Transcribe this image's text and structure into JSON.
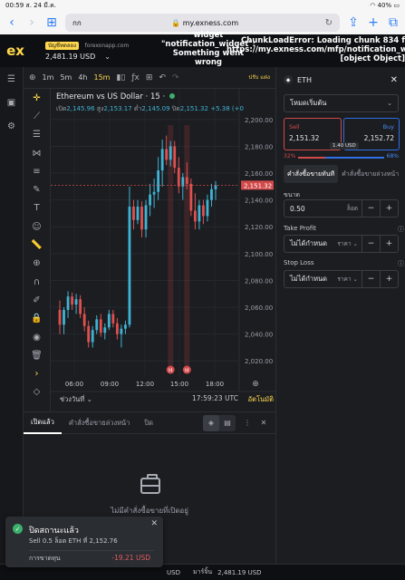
{
  "statusbar": {
    "time": "00:59",
    "date": "ส. 24 มี.ค.",
    "battery": "40%"
  },
  "safari": {
    "aa": "กก",
    "url": "my.exness.com"
  },
  "header": {
    "logo": "ex",
    "account_tag": "บัญชีทดลอง",
    "server": "forexonapp.com",
    "balance": "2,481.19 USD",
    "notification_error": [
      "widget",
      "\"notification_widget\":",
      "Something went",
      "wrong"
    ],
    "chunk_error": [
      "ChunkLoadError: Loading chunk 834 f",
      "https://my.exness.com/mfp/notification_widget",
      "[object Object]"
    ]
  },
  "chart_toolbar": {
    "timeframes": [
      "1m",
      "5m",
      "4h",
      "15m"
    ],
    "active_timeframe": "15m",
    "right_label": "ปรับ แต่ง"
  },
  "chart": {
    "legend": "Ethereum vs US Dollar · 15 ·",
    "ohlc": {
      "open_label": "เปิด",
      "open": "2,145.96",
      "high_label": "สูง",
      "high": "2,153.17",
      "low_label": "ต่ำ",
      "low": "2,145.09",
      "close_label": "ปิด",
      "close": "2,151.32",
      "change": "+5.38 (+0"
    },
    "range_button": "ช่วงวันที่",
    "clock": "17:59:23 UTC",
    "auto_button": "อัตโนมัติ",
    "colors": {
      "up": "#3fb3d4",
      "down": "#e0504f",
      "price_tag": "#d24a4a"
    }
  },
  "chart_data": {
    "type": "candlestick",
    "x_ticks": [
      "06:00",
      "09:00",
      "12:00",
      "15:00",
      "18:00"
    ],
    "y_ticks": [
      2020,
      2040,
      2060,
      2080,
      2100,
      2120,
      2140,
      2160,
      2180,
      2200
    ],
    "y_tick_labels": [
      "2,020.00",
      "2,040.00",
      "2,060.00",
      "2,080.00",
      "2,100.00",
      "2,120.00",
      "2,140.00",
      "2,160.00",
      "2,180.00",
      "2,200.00"
    ],
    "ylim": [
      2008,
      2208
    ],
    "current_price": "2,151.32",
    "candles": [
      {
        "o": 2058,
        "h": 2065,
        "l": 2040,
        "c": 2047
      },
      {
        "o": 2047,
        "h": 2060,
        "l": 2040,
        "c": 2058
      },
      {
        "o": 2058,
        "h": 2072,
        "l": 2052,
        "c": 2068
      },
      {
        "o": 2068,
        "h": 2071,
        "l": 2058,
        "c": 2062
      },
      {
        "o": 2062,
        "h": 2070,
        "l": 2055,
        "c": 2066
      },
      {
        "o": 2066,
        "h": 2069,
        "l": 2052,
        "c": 2055
      },
      {
        "o": 2055,
        "h": 2060,
        "l": 2042,
        "c": 2046
      },
      {
        "o": 2046,
        "h": 2050,
        "l": 2030,
        "c": 2034
      },
      {
        "o": 2034,
        "h": 2046,
        "l": 2030,
        "c": 2043
      },
      {
        "o": 2043,
        "h": 2054,
        "l": 2040,
        "c": 2051
      },
      {
        "o": 2051,
        "h": 2055,
        "l": 2038,
        "c": 2041
      },
      {
        "o": 2041,
        "h": 2048,
        "l": 2036,
        "c": 2045
      },
      {
        "o": 2045,
        "h": 2058,
        "l": 2043,
        "c": 2055
      },
      {
        "o": 2055,
        "h": 2058,
        "l": 2045,
        "c": 2048
      },
      {
        "o": 2048,
        "h": 2052,
        "l": 2036,
        "c": 2040
      },
      {
        "o": 2040,
        "h": 2047,
        "l": 2030,
        "c": 2044
      },
      {
        "o": 2044,
        "h": 2050,
        "l": 2040,
        "c": 2047
      },
      {
        "o": 2047,
        "h": 2150,
        "l": 2045,
        "c": 2135
      },
      {
        "o": 2135,
        "h": 2140,
        "l": 2118,
        "c": 2125
      },
      {
        "o": 2125,
        "h": 2140,
        "l": 2122,
        "c": 2135
      },
      {
        "o": 2135,
        "h": 2139,
        "l": 2112,
        "c": 2118
      },
      {
        "o": 2118,
        "h": 2140,
        "l": 2112,
        "c": 2136
      },
      {
        "o": 2136,
        "h": 2152,
        "l": 2128,
        "c": 2144
      },
      {
        "o": 2144,
        "h": 2156,
        "l": 2134,
        "c": 2146
      },
      {
        "o": 2146,
        "h": 2172,
        "l": 2140,
        "c": 2162
      },
      {
        "o": 2162,
        "h": 2185,
        "l": 2150,
        "c": 2178
      },
      {
        "o": 2178,
        "h": 2188,
        "l": 2166,
        "c": 2170
      },
      {
        "o": 2170,
        "h": 2184,
        "l": 2165,
        "c": 2180
      },
      {
        "o": 2180,
        "h": 2184,
        "l": 2160,
        "c": 2164
      },
      {
        "o": 2164,
        "h": 2172,
        "l": 2145,
        "c": 2150
      },
      {
        "o": 2150,
        "h": 2160,
        "l": 2140,
        "c": 2157
      },
      {
        "o": 2157,
        "h": 2168,
        "l": 2148,
        "c": 2152
      },
      {
        "o": 2152,
        "h": 2156,
        "l": 2128,
        "c": 2132
      },
      {
        "o": 2132,
        "h": 2145,
        "l": 2118,
        "c": 2124
      },
      {
        "o": 2124,
        "h": 2140,
        "l": 2118,
        "c": 2136
      },
      {
        "o": 2136,
        "h": 2140,
        "l": 2122,
        "c": 2128
      },
      {
        "o": 2128,
        "h": 2144,
        "l": 2124,
        "c": 2140
      },
      {
        "o": 2140,
        "h": 2152,
        "l": 2135,
        "c": 2148
      },
      {
        "o": 2148,
        "h": 2154,
        "l": 2140,
        "c": 2151
      }
    ],
    "event_marks": [
      {
        "candle": 27,
        "label": "H"
      },
      {
        "candle": 31,
        "label": "H"
      }
    ]
  },
  "trade_panel": {
    "symbol": "ETH",
    "order_type": "โหมดเริ่มต้น",
    "sell_label": "Sell",
    "sell_price": "2,151.32",
    "buy_label": "Buy",
    "buy_price": "2,152.72",
    "spread": "1.40 USD",
    "sell_pct": "32%",
    "buy_pct": "68%",
    "sell_ratio": 0.32,
    "tab_market": "คำสั่งซื้อขายทันที",
    "tab_pending": "คำสั่งซื้อขายล่วงหน้า",
    "volume_label": "ขนาด",
    "volume_value": "0.50",
    "volume_unit": "ล็อต",
    "tp_label": "Take Profit",
    "tp_value": "ไม่ได้กำหนด",
    "tp_unit": "ราคา",
    "sl_label": "Stop Loss",
    "sl_value": "ไม่ได้กำหนด",
    "sl_unit": "ราคา"
  },
  "bottom_panel": {
    "tabs": [
      "เปิดแล้ว",
      "คำสั่งซื้อขายล่วงหน้า",
      "ปิด"
    ],
    "empty_text": "ไม่มีคำสั่งซื้อขายที่เปิดอยู่"
  },
  "footer": {
    "currency": "USD",
    "label": "มาร์จิ้น",
    "value": "2,481.19 USD"
  },
  "toast": {
    "title": "ปิดสถานะแล้ว",
    "detail": "Sell 0.5 ล็อต ETH ที่ 2,152.76",
    "pl_label": "การขาดทุน",
    "pl_value": "-19.21 USD"
  }
}
